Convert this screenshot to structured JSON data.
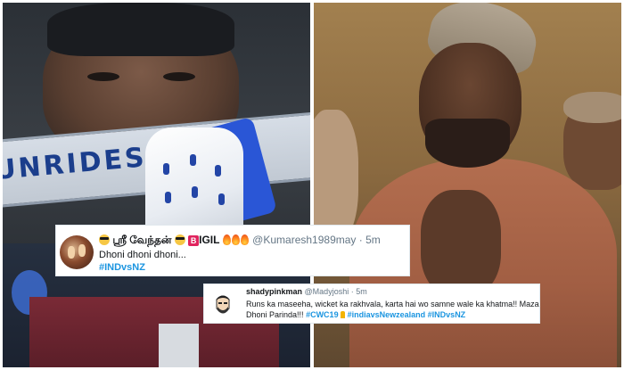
{
  "left_photo": {
    "banner_text": "UNRIDES"
  },
  "tweet1": {
    "display_name": "ஸ்ரீ வேந்தன்",
    "brand": "IGIL",
    "brand_badge": "B",
    "handle": "@Kumaresh1989may",
    "time": "5m",
    "text_line1": "Dhoni dhoni dhoni...",
    "hashtag": "#INDvsNZ"
  },
  "tweet2": {
    "display_name": "shadypinkman",
    "handle": "@Madyjoshi",
    "time": "5m",
    "text_line1": "Runs ka maseeha, wicket ka rakhvala, karta hai wo samne wale ka khatma!! Maza",
    "text_line2_plain": "Dhoni Parinda!!!",
    "hashtags": [
      "#CWC19",
      "#indiavsNewzealand",
      "#INDvsNZ"
    ]
  },
  "colors": {
    "hashtag": "#1b95e0",
    "handle": "#657786",
    "badge": "#e0245e",
    "banner_text": "#1b3e8c"
  },
  "icons": [
    "sunglasses-emoji-icon",
    "fire-emoji-icon",
    "trophy-emoji-icon",
    "b-badge-icon",
    "avatar-icon"
  ]
}
